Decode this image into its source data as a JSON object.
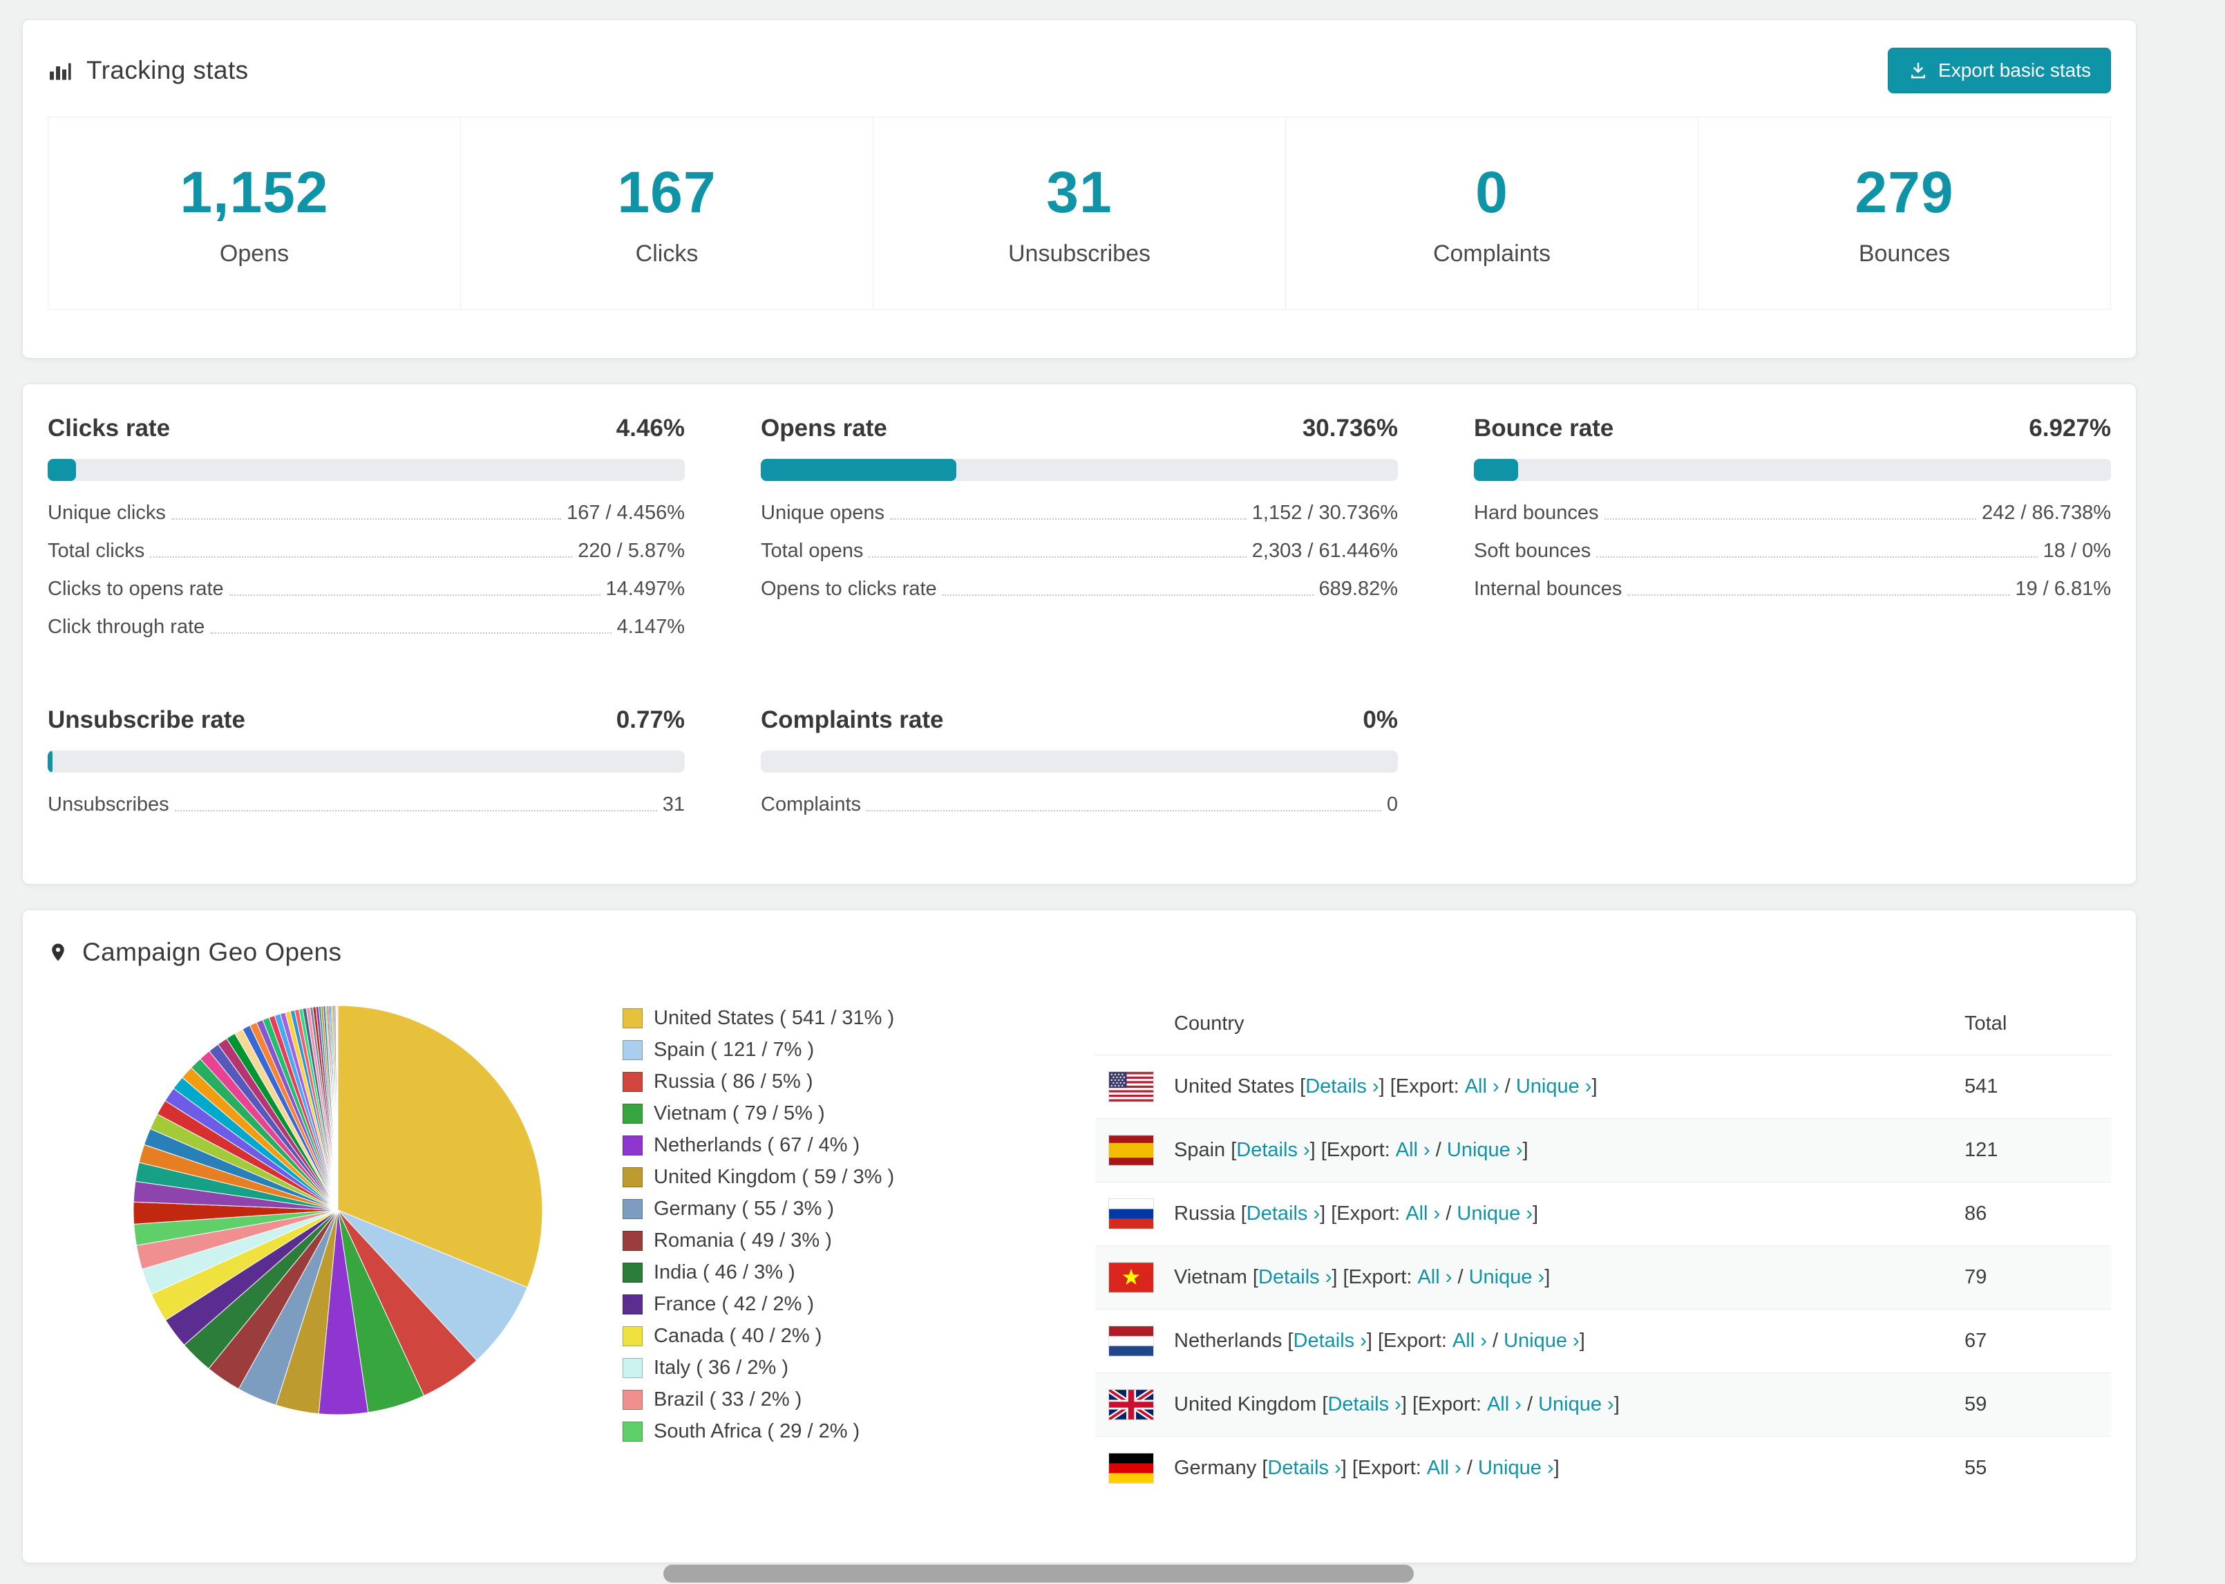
{
  "accent_color": "#0e93a7",
  "tracking": {
    "title": "Tracking stats",
    "export_button": "Export basic stats",
    "stats": [
      {
        "value": "1,152",
        "label": "Opens"
      },
      {
        "value": "167",
        "label": "Clicks"
      },
      {
        "value": "31",
        "label": "Unsubscribes"
      },
      {
        "value": "0",
        "label": "Complaints"
      },
      {
        "value": "279",
        "label": "Bounces"
      }
    ]
  },
  "rates": [
    {
      "title": "Clicks rate",
      "value": "4.46%",
      "percent": 4.46,
      "rows": [
        {
          "label": "Unique clicks",
          "value": "167 / 4.456%"
        },
        {
          "label": "Total clicks",
          "value": "220 / 5.87%"
        },
        {
          "label": "Clicks to opens rate",
          "value": "14.497%"
        },
        {
          "label": "Click through rate",
          "value": "4.147%"
        }
      ]
    },
    {
      "title": "Opens rate",
      "value": "30.736%",
      "percent": 30.736,
      "rows": [
        {
          "label": "Unique opens",
          "value": "1,152 / 30.736%"
        },
        {
          "label": "Total opens",
          "value": "2,303 / 61.446%"
        },
        {
          "label": "Opens to clicks rate",
          "value": "689.82%"
        }
      ]
    },
    {
      "title": "Bounce rate",
      "value": "6.927%",
      "percent": 6.927,
      "rows": [
        {
          "label": "Hard bounces",
          "value": "242 / 86.738%"
        },
        {
          "label": "Soft bounces",
          "value": "18 / 0%"
        },
        {
          "label": "Internal bounces",
          "value": "19 / 6.81%"
        }
      ]
    },
    {
      "title": "Unsubscribe rate",
      "value": "0.77%",
      "percent": 0.77,
      "rows": [
        {
          "label": "Unsubscribes",
          "value": "31"
        }
      ]
    },
    {
      "title": "Complaints rate",
      "value": "0%",
      "percent": 0,
      "rows": [
        {
          "label": "Complaints",
          "value": "0"
        }
      ]
    }
  ],
  "geo": {
    "title": "Campaign Geo Opens",
    "table": {
      "country_header": "Country",
      "total_header": "Total",
      "details_label": "Details ›",
      "export_label": "Export:",
      "all_label": "All ›",
      "unique_label": "Unique ›",
      "rows": [
        {
          "country": "United States",
          "total": "541",
          "flag": "us"
        },
        {
          "country": "Spain",
          "total": "121",
          "flag": "es"
        },
        {
          "country": "Russia",
          "total": "86",
          "flag": "ru"
        },
        {
          "country": "Vietnam",
          "total": "79",
          "flag": "vn"
        },
        {
          "country": "Netherlands",
          "total": "67",
          "flag": "nl"
        },
        {
          "country": "United Kingdom",
          "total": "59",
          "flag": "gb"
        },
        {
          "country": "Germany",
          "total": "55",
          "flag": "de"
        }
      ]
    }
  },
  "chart_data": {
    "type": "pie",
    "title": "Campaign Geo Opens",
    "unit": "opens",
    "legend_position": "right",
    "slices": [
      {
        "label": "United States",
        "value": 541,
        "pct": "31",
        "color": "#e7c13b"
      },
      {
        "label": "Spain",
        "value": 121,
        "pct": "7",
        "color": "#a9cfec"
      },
      {
        "label": "Russia",
        "value": 86,
        "pct": "5",
        "color": "#d0453e"
      },
      {
        "label": "Vietnam",
        "value": 79,
        "pct": "5",
        "color": "#38a63e"
      },
      {
        "label": "Netherlands",
        "value": 67,
        "pct": "4",
        "color": "#8e36cf"
      },
      {
        "label": "United Kingdom",
        "value": 59,
        "pct": "3",
        "color": "#bd9b2f"
      },
      {
        "label": "Germany",
        "value": 55,
        "pct": "3",
        "color": "#7d9dc0"
      },
      {
        "label": "Romania",
        "value": 49,
        "pct": "3",
        "color": "#9c3d3d"
      },
      {
        "label": "India",
        "value": 46,
        "pct": "3",
        "color": "#2d7d3a"
      },
      {
        "label": "France",
        "value": 42,
        "pct": "2",
        "color": "#5c2d91"
      },
      {
        "label": "Canada",
        "value": 40,
        "pct": "2",
        "color": "#efe23e"
      },
      {
        "label": "Italy",
        "value": 36,
        "pct": "2",
        "color": "#cdf3f0"
      },
      {
        "label": "Brazil",
        "value": 33,
        "pct": "2",
        "color": "#f08f8f"
      },
      {
        "label": "South Africa",
        "value": 29,
        "pct": "2",
        "color": "#5fcf6a"
      }
    ],
    "others": {
      "note": "remaining small countries drawn as thin unlabeled slices",
      "values": [
        30,
        28,
        26,
        25,
        23,
        22,
        21,
        20,
        19,
        18,
        17,
        16,
        15,
        14,
        13,
        12,
        11,
        10,
        9,
        9,
        8,
        8,
        7,
        7,
        6,
        6,
        5,
        5,
        5,
        4,
        4,
        4,
        3,
        3,
        3,
        2,
        2,
        2,
        2,
        2,
        2,
        2,
        1,
        1,
        1
      ],
      "palette": [
        "#c2270f",
        "#8e44ad",
        "#16a085",
        "#e67e22",
        "#2980b9",
        "#a3cb38",
        "#d63031",
        "#6c5ce7",
        "#00a8cc",
        "#f39c12",
        "#27ae60",
        "#e84393",
        "#5758bb",
        "#b53471",
        "#009432",
        "#f7d794",
        "#3867d6",
        "#fa8231",
        "#8854d0",
        "#20bf6b",
        "#eb3b5a",
        "#45aaf2",
        "#a55eea",
        "#fed330",
        "#2d98da",
        "#fc5c65",
        "#26de81",
        "#4b6584",
        "#f78fb3",
        "#778ca3"
      ]
    }
  }
}
